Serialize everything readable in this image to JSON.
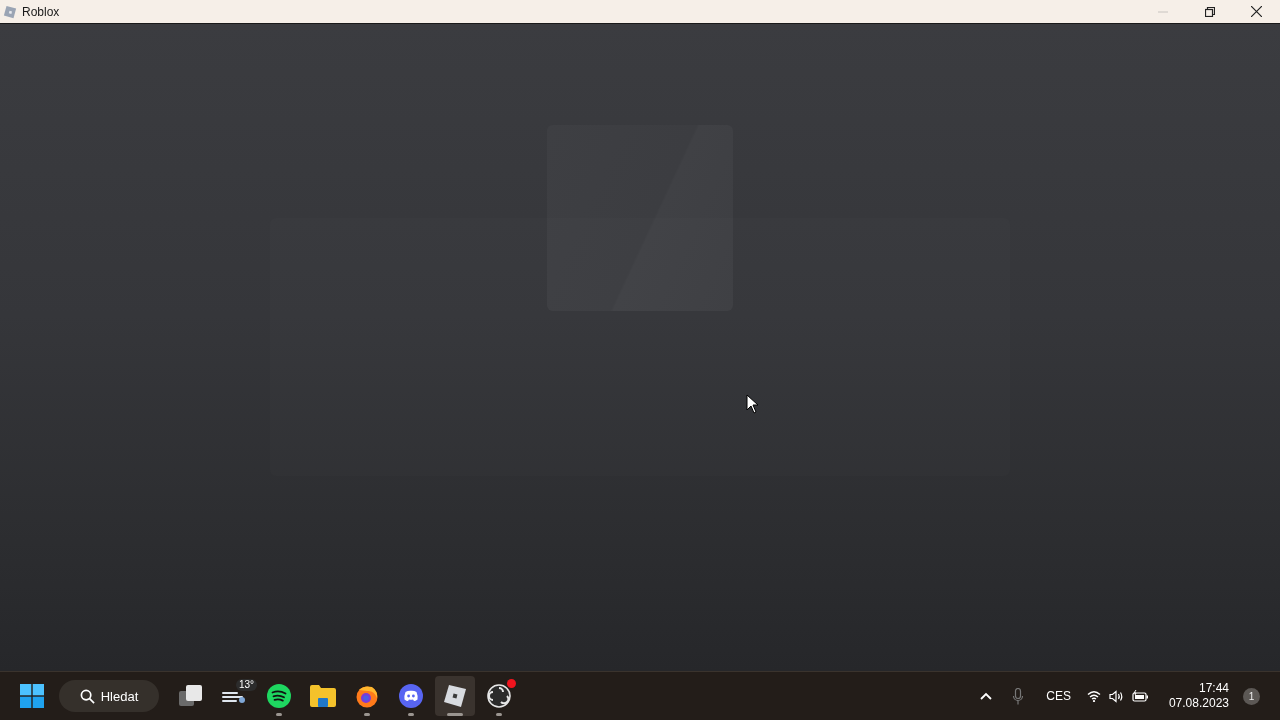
{
  "window": {
    "title": "Roblox"
  },
  "taskbar": {
    "search": {
      "label": "Hledat"
    },
    "apps": [
      {
        "kind": "task-view",
        "running": false,
        "selected": false
      },
      {
        "kind": "weather",
        "badge": "13°",
        "running": false,
        "selected": false
      },
      {
        "kind": "spotify",
        "running": true,
        "selected": false
      },
      {
        "kind": "explorer",
        "running": false,
        "selected": false
      },
      {
        "kind": "firefox",
        "running": true,
        "selected": false
      },
      {
        "kind": "discord",
        "running": true,
        "selected": false
      },
      {
        "kind": "roblox",
        "running": true,
        "selected": true
      },
      {
        "kind": "obs",
        "running": true,
        "selected": false,
        "alert": true
      }
    ],
    "tray": {
      "language": "CES",
      "time": "17:44",
      "date": "07.08.2023",
      "notifications": "1"
    }
  }
}
